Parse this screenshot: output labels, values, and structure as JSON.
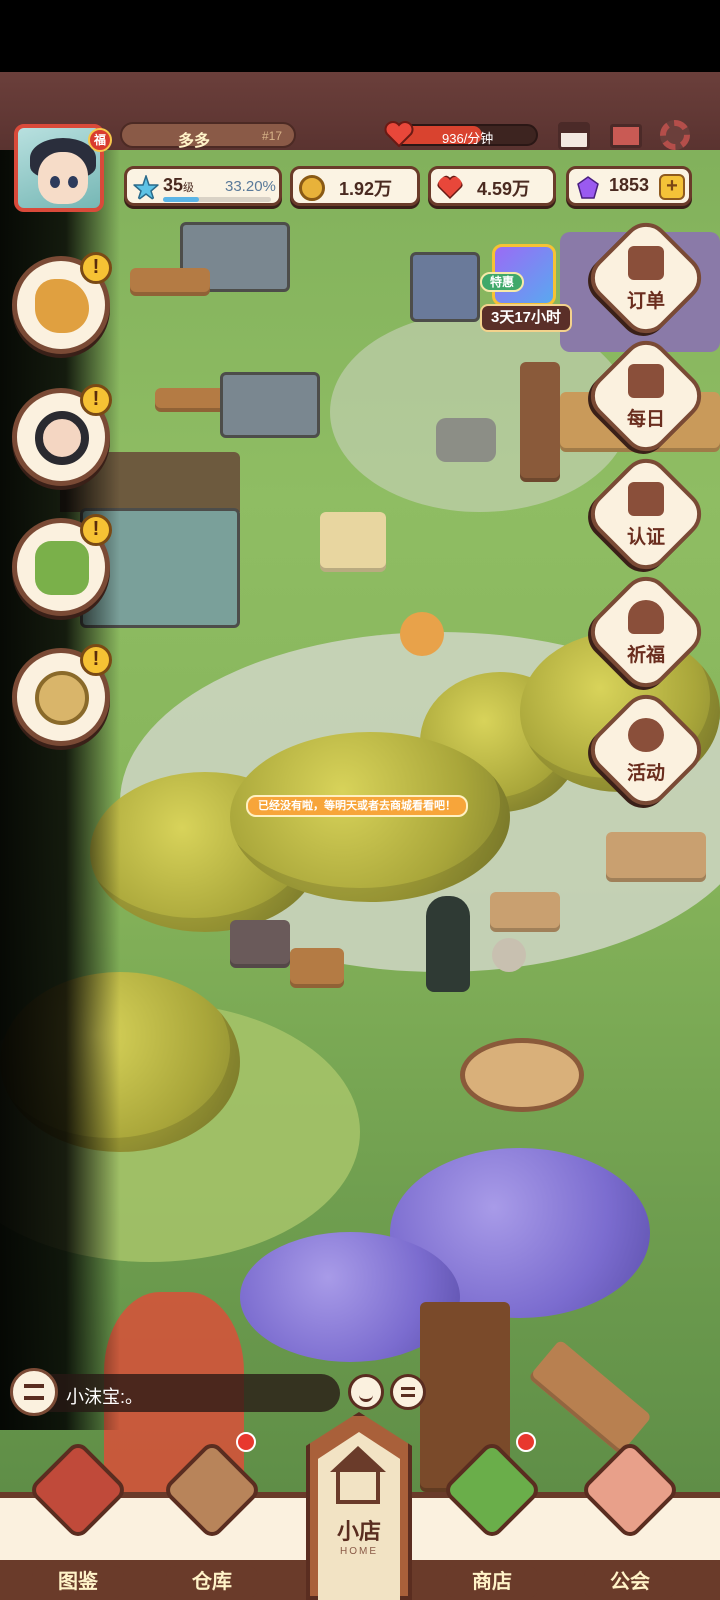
{
  "player": {
    "name": "多多",
    "id_tag": "#17",
    "badge": "福",
    "level": "35",
    "level_unit": "级",
    "level_progress": "33.20%",
    "level_progress_fraction": 0.332
  },
  "energy": {
    "rate_text": "936/分钟",
    "fill_fraction": 0.62
  },
  "resources": {
    "coins": "1.92万",
    "hearts": "4.59万",
    "gems": "1853",
    "gems_add": "+"
  },
  "left_alerts": {
    "mark": "!"
  },
  "gift": {
    "tag": "特惠",
    "timer": "3天17小时"
  },
  "right_menu": [
    {
      "label": "订单",
      "icon": "order-icon"
    },
    {
      "label": "每日",
      "icon": "daily-icon"
    },
    {
      "label": "认证",
      "icon": "id-card-icon"
    },
    {
      "label": "祈福",
      "icon": "pray-icon"
    },
    {
      "label": "活动",
      "icon": "event-icon"
    }
  ],
  "map_tip": "已经没有啦，等明天或者去商城看看吧！",
  "chat": {
    "text": "小沫宝:。"
  },
  "bottom_nav": {
    "collection": "图鉴",
    "warehouse": "仓库",
    "home": "小店",
    "home_sub": "HOME",
    "shop": "商店",
    "guild": "公会"
  },
  "colors": {
    "hud_brown": "#6b3f3b",
    "cream": "#fbf1df",
    "alert_yellow": "#f6c234",
    "notify_red": "#e8382e"
  }
}
